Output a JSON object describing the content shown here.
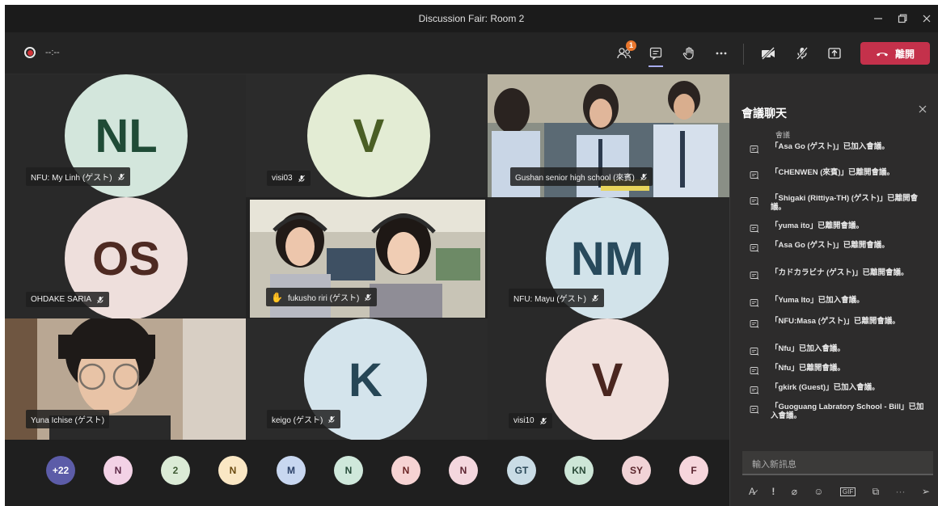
{
  "window": {
    "title": "Discussion Fair: Room 2"
  },
  "toolbar": {
    "timer": "--:--",
    "participants_badge": "1",
    "leave_label": "離開"
  },
  "tiles": [
    {
      "name": "NFU: My Linh (ゲスト)",
      "initials": "NL",
      "avatar_bg": "#d3e6dc",
      "avatar_fg": "#1f4b36"
    },
    {
      "name": "visi03",
      "initials": "V",
      "avatar_bg": "#e3ecd4",
      "avatar_fg": "#4a5e24"
    },
    {
      "name": "Gushan senior high school (來賓)"
    },
    {
      "name": "OHDAKE SARIA",
      "initials": "OS",
      "avatar_bg": "#eedfdc",
      "avatar_fg": "#4e2a22"
    },
    {
      "name": "fukusho riri (ゲスト)"
    },
    {
      "name": "NFU: Mayu (ゲスト)",
      "initials": "NM",
      "avatar_bg": "#d2e3ea",
      "avatar_fg": "#284a5c"
    },
    {
      "name": "Yuna Ichise (ゲスト)"
    },
    {
      "name": "keigo (ゲスト)",
      "initials": "K",
      "avatar_bg": "#d4e4ec",
      "avatar_fg": "#264656"
    },
    {
      "name": "visi10",
      "initials": "V",
      "avatar_bg": "#f0e0dc",
      "avatar_fg": "#4a261f"
    }
  ],
  "strip": [
    {
      "label": "+22",
      "bg": "#5c5ca8",
      "fg": "#ffffff"
    },
    {
      "label": "N",
      "bg": "#f3d2e6",
      "fg": "#5e2a48"
    },
    {
      "label": "2",
      "bg": "#dbebd6",
      "fg": "#3d5a33"
    },
    {
      "label": "N",
      "bg": "#fae7c4",
      "fg": "#6a4a10"
    },
    {
      "label": "M",
      "bg": "#c8d7f0",
      "fg": "#2a3f66"
    },
    {
      "label": "N",
      "bg": "#cfe8db",
      "fg": "#254a38"
    },
    {
      "label": "N",
      "bg": "#f6d3d3",
      "fg": "#6a2424"
    },
    {
      "label": "N",
      "bg": "#f4d7de",
      "fg": "#5c2430"
    },
    {
      "label": "GT",
      "bg": "#c9dce5",
      "fg": "#294656"
    },
    {
      "label": "KN",
      "bg": "#cde6d7",
      "fg": "#284836"
    },
    {
      "label": "SY",
      "bg": "#f1d3d6",
      "fg": "#5a262c"
    },
    {
      "label": "F",
      "bg": "#f6d6dc",
      "fg": "#5a2530"
    }
  ],
  "chat": {
    "title": "會議聊天",
    "clipped_top": "會議",
    "messages": [
      "「Asa Go (ゲスト)」已加入會議。",
      "「CHENWEN (來賓)」已離開會議。",
      "「Shigaki (Rittiya-TH) (ゲスト)」已離開會議。",
      "「yuma ito」已離開會議。",
      "「Asa Go (ゲスト)」已離開會議。",
      "「カドカラビナ (ゲスト)」已離開會議。",
      "「Yuma Ito」已加入會議。",
      "「NFU:Masa (ゲスト)」已離開會議。",
      "「Nfu」已加入會議。",
      "「Nfu」已離開會議。",
      "「gkirk (Guest)」已加入會議。",
      "「Guoguang Labratory School - Bill」已加入會議。"
    ],
    "compose_placeholder": "輸入新訊息"
  },
  "colors": {
    "leave": "#c4314b",
    "accent": "#a7acee",
    "badge": "#e9772e"
  }
}
